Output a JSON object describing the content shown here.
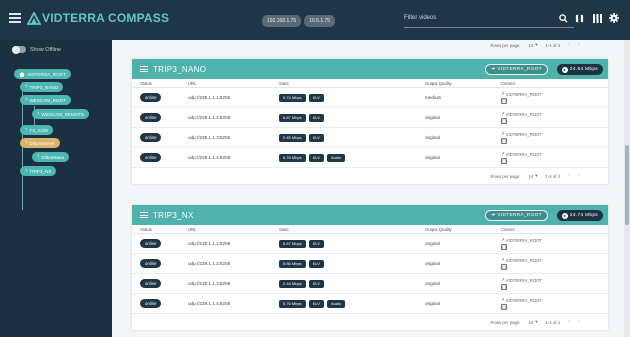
{
  "app": {
    "logo_text": "VIDTERRA COMPASS"
  },
  "header": {
    "ip_chips": [
      "192.168.1.75",
      "10.5.1.75"
    ],
    "filter_placeholder": "Filter videos"
  },
  "sidebar": {
    "show_offline_label": "Show Offline",
    "tree": [
      {
        "label": "VIDTERRA_ROOT",
        "icon": "home-icon",
        "selected": false
      },
      {
        "label": "TRIP3_NANO",
        "icon": "arrow-up-icon",
        "selected": false
      },
      {
        "label": "WESCAM_ROOT",
        "icon": "arrow-up-icon",
        "selected": false
      },
      {
        "label": "WESCAM_REMOTE",
        "icon": "arrow-up-icon",
        "selected": false
      },
      {
        "label": "TX_KXM",
        "icon": "arrow-up-icon",
        "selected": false
      },
      {
        "label": "DiltonServer",
        "icon": "arrow-up-icon",
        "selected": true
      },
      {
        "label": "DiltonNano",
        "icon": "arrow-up-icon",
        "selected": false
      },
      {
        "label": "TRIP3_NX",
        "icon": "arrow-up-icon",
        "selected": false
      }
    ]
  },
  "top_pagination": {
    "rows_label": "Rows per page:",
    "rows_value": "10",
    "range": "1-4 of 4"
  },
  "table_headers": {
    "status": "Status",
    "url": "URL",
    "stats": "Stats",
    "quality": "Output Quality",
    "control": "Control"
  },
  "cards": [
    {
      "title": "TRIP3_NANO",
      "route_button": "VIDTERRA_ROOT",
      "bandwidth": "24.84 Mbps",
      "rows": [
        {
          "status": "online",
          "url": "udp://239.1.1.1:8208",
          "rate": "5.74 Mbps",
          "codec": "KLV",
          "audio": "",
          "quality": "medium",
          "control": "VIDTERRA_ROOT"
        },
        {
          "status": "online",
          "url": "udp://239.1.1.2:8208",
          "rate": "6.87 Mbps",
          "codec": "KLV",
          "audio": "",
          "quality": "original",
          "control": "VIDTERRA_ROOT"
        },
        {
          "status": "online",
          "url": "udp://239.1.1.3:8208",
          "rate": "2.45 Mbps",
          "codec": "KLV",
          "audio": "",
          "quality": "original",
          "control": "VIDTERRA_ROOT"
        },
        {
          "status": "online",
          "url": "udp://239.1.1.4:8208",
          "rate": "5.78 Mbps",
          "codec": "KLV",
          "audio": "Audio",
          "quality": "original",
          "control": "VIDTERRA_ROOT"
        }
      ],
      "pagination": {
        "rows_label": "Rows per page:",
        "rows_value": "10",
        "range": "1-4 of 4"
      }
    },
    {
      "title": "TRIP3_NX",
      "route_button": "VIDTERRA_ROOT",
      "bandwidth": "24.74 Mbps",
      "rows": [
        {
          "status": "online",
          "url": "udp://239.1.1.1:8208",
          "rate": "5.67 Mbps",
          "codec": "KLV",
          "audio": "",
          "quality": "original",
          "control": "VIDTERRA_ROOT"
        },
        {
          "status": "online",
          "url": "udp://239.1.1.2:8208",
          "rate": "5.86 Mbps",
          "codec": "KLV",
          "audio": "",
          "quality": "original",
          "control": "VIDTERRA_ROOT"
        },
        {
          "status": "online",
          "url": "udp://239.1.1.3:8208",
          "rate": "2.44 Mbps",
          "codec": "KLV",
          "audio": "",
          "quality": "original",
          "control": "VIDTERRA_ROOT"
        },
        {
          "status": "online",
          "url": "udp://239.1.1.4:8208",
          "rate": "5.76 Mbps",
          "codec": "KLV",
          "audio": "Audio",
          "quality": "original",
          "control": "VIDTERRA_ROOT"
        }
      ],
      "pagination": {
        "rows_label": "Rows per page:",
        "rows_value": "10",
        "range": "1-4 of 4"
      }
    }
  ],
  "colors": {
    "accent": "#4fb2ad",
    "dark": "#1f3646",
    "selected_node": "#d9b46a"
  }
}
